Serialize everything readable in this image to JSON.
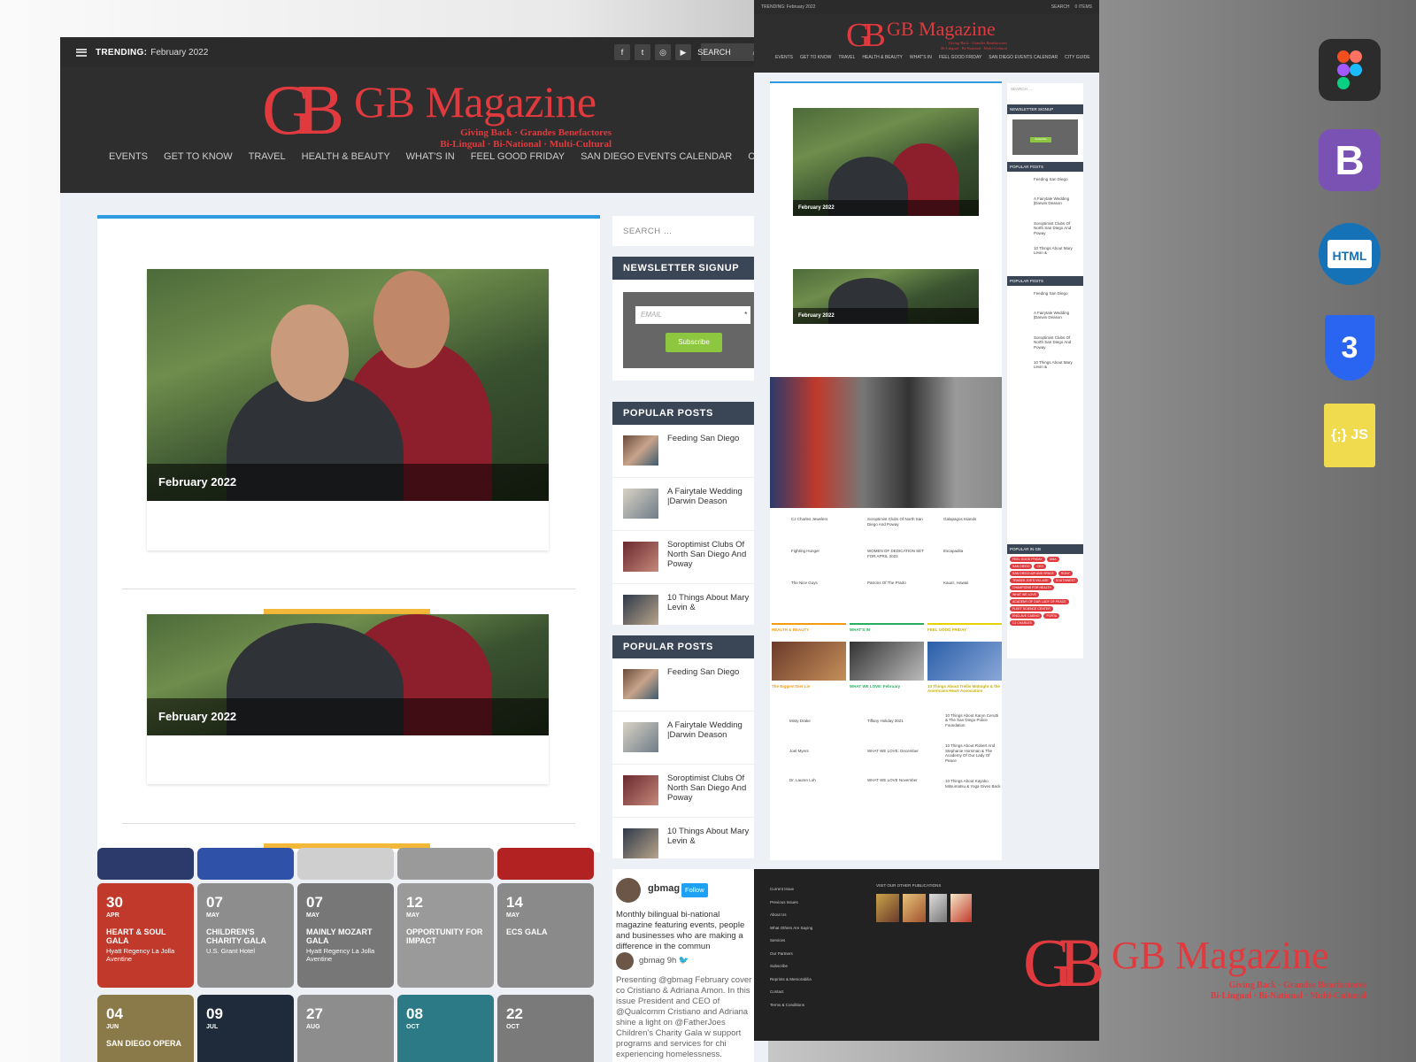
{
  "big": {
    "topbar": {
      "trending_label": "TRENDING:",
      "trending_value": "February 2022",
      "search_label": "SEARCH"
    },
    "brand": {
      "monogram": "GB",
      "name": "GB Magazine",
      "tagline_line1": "Giving Back · Grandes Benefactores",
      "tagline_line2": "Bi-Lingual · Bi-National · Multi-Cultural",
      "tm": "™"
    },
    "nav": [
      "EVENTS",
      "GET TO KNOW",
      "TRAVEL",
      "HEALTH & BEAUTY",
      "WHAT'S IN",
      "FEEL GOOD FRIDAY",
      "SAN DIEGO EVENTS CALENDAR",
      "CITY GUI"
    ],
    "posts": [
      {
        "caption": "February 2022"
      },
      {
        "caption": "February 2022"
      }
    ],
    "search_placeholder": "SEARCH …",
    "newsletter": {
      "title": "NEWSLETTER SIGNUP",
      "email_placeholder": "EMAIL",
      "required": "*",
      "button": "Subscribe"
    },
    "popular_posts_title": "POPULAR POSTS",
    "popular_posts": [
      "Feeding San Diego",
      "A Fairytale Wedding |Darwin Deason",
      "Soroptimist Clubs Of North San Diego And Poway",
      "10 Things About Mary Levin &"
    ],
    "events_row1": [
      {
        "day": "30",
        "month": "APR",
        "title": "HEART & SOUL GALA",
        "loc": "Hyatt Regency La Jolla Aventine",
        "color": "#c0392b"
      },
      {
        "day": "07",
        "month": "MAY",
        "title": "CHILDREN'S CHARITY GALA",
        "loc": "U.S. Grant Hotel",
        "color": "#8d8d8d"
      },
      {
        "day": "07",
        "month": "MAY",
        "title": "MAINLY MOZART GALA",
        "loc": "Hyatt Regency La Jolla Aventine",
        "color": "#777777"
      },
      {
        "day": "12",
        "month": "MAY",
        "title": "OPPORTUNITY FOR IMPACT",
        "loc": "",
        "color": "#9a9a9a"
      },
      {
        "day": "14",
        "month": "MAY",
        "title": "ECS GALA",
        "loc": "",
        "color": "#8a8a8a"
      }
    ],
    "events_row2": [
      {
        "day": "04",
        "month": "JUN",
        "title": "SAN DIEGO OPERA",
        "color": "#8a7a4a"
      },
      {
        "day": "09",
        "month": "JUL",
        "title": "",
        "color": "#1f2b3a"
      },
      {
        "day": "27",
        "month": "AUG",
        "title": "",
        "color": "#8d8d8d"
      },
      {
        "day": "08",
        "month": "OCT",
        "title": "",
        "color": "#2c7a86"
      },
      {
        "day": "22",
        "month": "OCT",
        "title": "",
        "color": "#7a7a7a"
      }
    ],
    "twitter": {
      "handle": "gbmag",
      "follow": "Follow",
      "bio": "Monthly bilingual bi-national magazine featuring events, people and businesses who are making a difference in the commun",
      "tweet_time": "9h",
      "tweet": "Presenting @gbmag February cover co Cristiano & Adriana Amon. In this issue President and CEO of @Qualcomm Cristiano and Adriana shine a light on @FatherJoes Children's Charity Gala w support programs and services for chi experiencing homelessness."
    }
  },
  "full": {
    "topbar": {
      "trending": "TRENDING: February 2022",
      "search": "SEARCH",
      "items": "0 ITEMS"
    },
    "nav": [
      "EVENTS",
      "GET TO KNOW",
      "TRAVEL",
      "HEALTH & BEAUTY",
      "WHAT'S IN",
      "FEEL GOOD FRIDAY",
      "SAN DIEGO EVENTS CALENDAR",
      "CITY GUIDE"
    ],
    "captions": [
      "February 2022",
      "February 2022"
    ],
    "side": {
      "search": "SEARCH …",
      "newsletter": "NEWSLETTER SIGNUP",
      "popular": "POPULAR POSTS",
      "popular_in_gb": "POPULAR IN GB",
      "subscribe": "Subscribe"
    },
    "side_posts": [
      "Feeding San Diego",
      "A Fairytale Wedding |Darwin Deason",
      "Soroptimist Clubs Of North San Diego And Poway",
      "10 Things About Mary Levin &"
    ],
    "tags": [
      "FEEL GOOD FRIDAY",
      "DMA",
      "SAN DIEGO",
      "CEO",
      "SAN DIEGO AIR AND SPACE",
      "RONY",
      "TRADER JOE'S VILLAGE",
      "SOUTHWEST",
      "CHAMPIONS FOR HEALTH",
      "WHAT WE LOVE",
      "ACADEMY OF OUR LADY OF PEACE",
      "FLEET SCIENCE CENTER",
      "ENCLAVE CASINO",
      "PORTA",
      "CJ CHARLES"
    ],
    "columns": [
      {
        "title": "HEALTH & BEAUTY",
        "color": "#f39c12",
        "lead": "The Biggest Diet Lie",
        "items": [
          "Misty Drake",
          "Joel Myers",
          "Dr. Lauren Loh"
        ]
      },
      {
        "title": "WHAT'S IN",
        "color": "#27ae60",
        "lead": "WHAT WE LOVE: February",
        "items": [
          "Tiffany Holiday 2021",
          "WHAT WE LOVE: December",
          "WHAT WE LOVE November"
        ]
      },
      {
        "title": "FEEL GOOD FRIDAY",
        "color": "#e6d200",
        "lead": "10 Things About Trellis Midnight & the Americans Heart Association",
        "items": [
          "10 Things About Karyn Cerutti & The San Diego Police Foundation",
          "10 Things About Robert And Stephanie Horsman & The Academy Of Our Lady Of Peace",
          "10 Things About Kayoko Mitsumatsu & Yoga Gives Back"
        ]
      }
    ],
    "mini_posts": [
      "CJ Charles Jewelers",
      "Soroptimist Clubs Of North San Diego And Poway",
      "Galapagos Islands",
      "Fighting Hunger",
      "WOMEN OF DEDICATION SET FOR APRIL 2022",
      "Escapadita",
      "The Nice Guys",
      "Patrons Of The Prado",
      "Kaua'i, Hawaii"
    ],
    "footer": {
      "links": [
        "Current Issue",
        "Previous Issues",
        "About Us",
        "What Others Are Saying",
        "Services",
        "Our Partners",
        "Subscribe",
        "Reprints & Memorabilia",
        "Contact",
        "Terms & Conditions"
      ],
      "pubs_title": "VISIT OUR OTHER PUBLICATIONS"
    }
  },
  "brand_lockup": {
    "name": "GB Magazine",
    "monogram": "GB",
    "tagline_line1": "Giving Back · Grandes Benefactores",
    "tagline_line2": "Bi-Lingual · Bi-National · Multi-Cultural"
  },
  "tools": [
    {
      "name": "Figma",
      "color": "#2c2c2c"
    },
    {
      "name": "Bootstrap",
      "glyph": "B",
      "color": "#7952b3"
    },
    {
      "name": "HTML",
      "glyph": "HTML",
      "color": "#1572b6"
    },
    {
      "name": "CSS3",
      "glyph": "3",
      "color": "#2965f1"
    },
    {
      "name": "JS",
      "glyph": "{;} JS",
      "color": "#f0db4f"
    }
  ]
}
